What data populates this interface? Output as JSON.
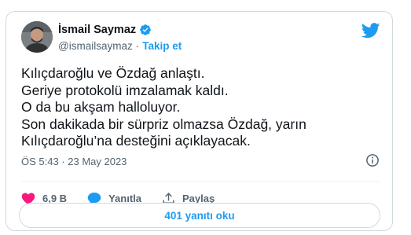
{
  "author": {
    "name": "İsmail Saymaz",
    "handle": "@ismailsaymaz",
    "separator": "·",
    "follow_label": "Takip et"
  },
  "tweet": {
    "lines": [
      "Kılıçdaroğlu ve Özdağ anlaştı.",
      "Geriye protokolü imzalamak kaldı.",
      "O da bu akşam halloluyor.",
      "Son dakikada bir sürpriz olmazsa Özdağ, yarın",
      "Kılıçdaroğlu’na desteğini açıklayacak."
    ],
    "timestamp": "ÖS 5:43 · 23 May 2023"
  },
  "actions": {
    "likes": "6,9 B",
    "reply_label": "Yanıtla",
    "share_label": "Paylaş"
  },
  "read_replies_label": "401 yanıtı oku",
  "colors": {
    "accent": "#1d9bf0",
    "like": "#f91880",
    "text": "#0f1419",
    "muted": "#536471",
    "border": "#cfd9de"
  },
  "icons": [
    "verified-badge-icon",
    "twitter-bird-icon",
    "info-icon",
    "heart-icon",
    "reply-bubble-icon",
    "share-icon"
  ]
}
